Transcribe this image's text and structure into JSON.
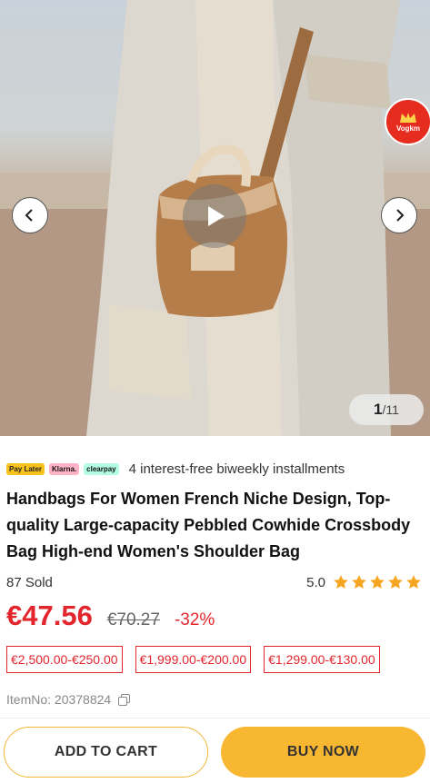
{
  "gallery": {
    "current": "1",
    "total": "/11",
    "badge_label": "Vogkm",
    "icons": {
      "prev": "chevron-left-icon",
      "next": "chevron-right-icon",
      "play": "play-icon"
    }
  },
  "payment": {
    "providers": [
      "Pay Later",
      "Klarna.",
      "clearpay"
    ],
    "text": "4 interest-free biweekly installments"
  },
  "product": {
    "title": "Handbags For Women French Niche Design, Top-quality Large-capacity Pebbled Cowhide Crossbody Bag High-end Women's Shoulder Bag",
    "sold": "87 Sold",
    "rating": "5.0",
    "stars": 5,
    "price": "€47.56",
    "original_price": "€70.27",
    "discount": "-32%",
    "coupons": [
      "€2,500.00-€250.00",
      "€1,999.00-€200.00",
      "€1,299.00-€130.00"
    ],
    "item_no": "ItemNo: 20378824"
  },
  "actions": {
    "add_to_cart": "ADD TO CART",
    "buy_now": "BUY NOW"
  },
  "colors": {
    "price_red": "#e3262d",
    "star": "#f6a623",
    "buy_bg": "#f7b731"
  }
}
